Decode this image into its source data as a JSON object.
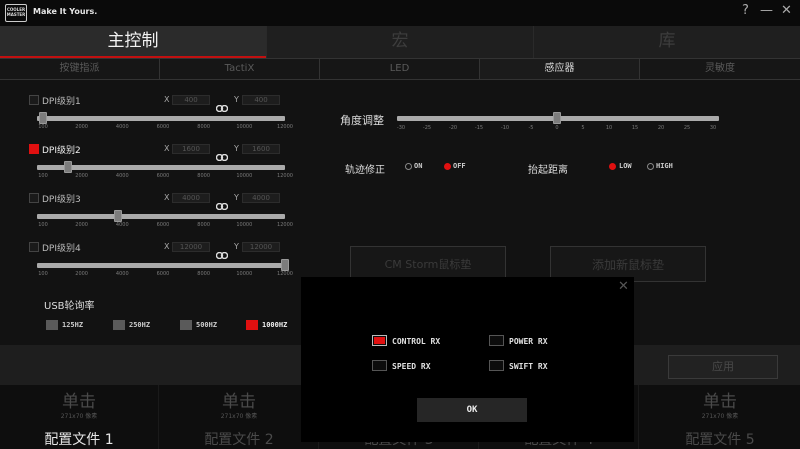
{
  "titlebar": {
    "logo_text": "COOLER MASTER",
    "tagline": "Make It Yours.",
    "help": "?",
    "minimize": "—",
    "close": "✕"
  },
  "main_tabs": [
    {
      "label": "主控制"
    },
    {
      "label": "宏"
    },
    {
      "label": "库"
    }
  ],
  "sub_tabs": [
    {
      "label": "按键指派"
    },
    {
      "label": "TactiX"
    },
    {
      "label": "LED"
    },
    {
      "label": "感应器"
    },
    {
      "label": "灵敏度"
    }
  ],
  "dpi_levels": [
    {
      "label": "DPI级别1",
      "checked": false,
      "x": "400",
      "y": "400"
    },
    {
      "label": "DPI级别2",
      "checked": true,
      "x": "1600",
      "y": "1600"
    },
    {
      "label": "DPI级别3",
      "checked": false,
      "x": "4000",
      "y": "4000"
    },
    {
      "label": "DPI级别4",
      "checked": false,
      "x": "12000",
      "y": "12000"
    }
  ],
  "axis": {
    "x": "X",
    "y": "Y"
  },
  "dpi_ticks": [
    "100",
    "2000",
    "4000",
    "6000",
    "8000",
    "10000",
    "12000"
  ],
  "angle": {
    "label": "角度调整",
    "ticks": [
      "-30",
      "-25",
      "-20",
      "-15",
      "-10",
      "-5",
      "0",
      "5",
      "10",
      "15",
      "20",
      "25",
      "30"
    ],
    "value": 0
  },
  "track_correction": {
    "label": "轨迹修正",
    "on": "ON",
    "off": "OFF",
    "selected": "OFF"
  },
  "lift_off": {
    "label": "抬起距离",
    "low": "LOW",
    "high": "HIGH",
    "selected": "LOW"
  },
  "usb_rate": {
    "label": "USB轮询率",
    "options": [
      {
        "label": "125HZ",
        "selected": false
      },
      {
        "label": "250HZ",
        "selected": false
      },
      {
        "label": "500HZ",
        "selected": false
      },
      {
        "label": "1000HZ",
        "selected": true
      }
    ]
  },
  "pad_buttons": {
    "storm_pad": "CM Storm鼠标垫",
    "add_pad": "添加新鼠标垫"
  },
  "apply_label": "应用",
  "profiles": [
    {
      "action": "单击",
      "size": "271x70 像素",
      "name": "配置文件 1"
    },
    {
      "action": "单击",
      "size": "271x70 像素",
      "name": "配置文件 2"
    },
    {
      "action": "",
      "size": "",
      "name": "配置文件 3"
    },
    {
      "action": "",
      "size": "",
      "name": "配置文件 4"
    },
    {
      "action": "单击",
      "size": "271x70 像素",
      "name": "配置文件 5"
    }
  ],
  "modal": {
    "close": "✕",
    "options": [
      {
        "label": "CONTROL RX",
        "checked": true
      },
      {
        "label": "POWER RX",
        "checked": false
      },
      {
        "label": "SPEED RX",
        "checked": false
      },
      {
        "label": "SWIFT RX",
        "checked": false
      }
    ],
    "ok": "OK"
  },
  "colors": {
    "accent": "#e01010",
    "background": "#121212"
  }
}
